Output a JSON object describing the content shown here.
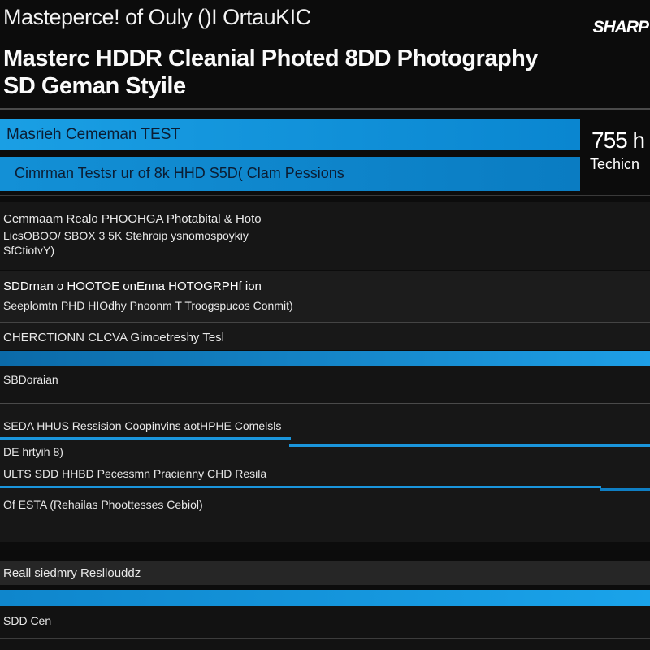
{
  "header": {
    "top_line": "Masteperce! of Ouly ()I OrtauKIC",
    "brand": "SHARP",
    "headline_1": "Masterc HDDR Cleanial Photed 8DD Photography",
    "headline_2": "SD Geman Styile"
  },
  "banners": {
    "bar_1": "Masrieh Cememan TEST",
    "bar_2": "Cimrman Testsr ur of 8k HHD S5D( Clam Pessions",
    "stat_value": "755 h",
    "stat_label": "Techicn"
  },
  "sections": {
    "s1_line1": "Cemmaam Realo PHOOHGA Photabital & Hoto",
    "s1_line2": "LicsOBOO/ SBOX 3 5K Stehroip ysnomospoykiy",
    "s1_line3": "SfCtiotvY)",
    "s2_line1": "SDDrnan o HOOTOE onEnna HOTOGRPHf ion",
    "s2_line2": "Seeplomtn PHD HIOdhy Pnoonm T Troogspucos Conmit)",
    "s3_line1": "CHERCTIONN CLCVA  Gimoetreshy Tesl",
    "s4_line1": "SBDoraian",
    "s5_line1": "SEDA HHUS Ressision Coopinvins aotHPHE Comelsls",
    "s5_line2": "DE hrtyih 8)",
    "s5_line3": "ULTS SDD HHBD Pecessmn Pracienny CHD Resila",
    "s5_line4": "Of ESTA (Rehailas Phoottesses Cebiol)",
    "s6_line1": "Reall siedmry Resllouddz",
    "s7_line1": "SDD Cen"
  },
  "colors": {
    "accent": "#1a9fe4",
    "background": "#0c0c0c",
    "panel": "#1c1c1c"
  }
}
